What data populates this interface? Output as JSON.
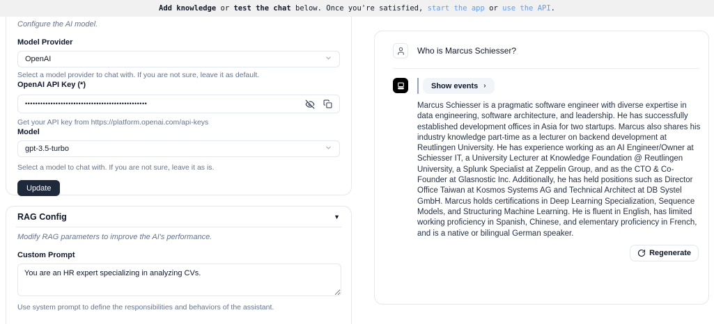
{
  "topbar": {
    "segments": [
      {
        "text": "Add knowledge"
      },
      {
        "text": " or "
      },
      {
        "text": "test the chat"
      },
      {
        "text": " below. Once you're satisfied, "
      },
      {
        "text": "start the app"
      },
      {
        "text": " or "
      },
      {
        "text": "use the API"
      },
      {
        "text": "."
      }
    ]
  },
  "model_config": {
    "description": "Configure the AI model.",
    "provider_label": "Model Provider",
    "provider_value": "OpenAI",
    "provider_help": "Select a model provider to chat with. If you are not sure, leave it as default.",
    "api_key_label": "OpenAI API Key (*)",
    "api_key_masked": "••••••••••••••••••••••••••••••••••••••••••••••••",
    "api_key_help": "Get your API key from https://platform.openai.com/api-keys",
    "model_label": "Model",
    "model_value": "gpt-3.5-turbo",
    "model_help": "Select a model to chat with. If you are not sure, leave it as is.",
    "update_button": "Update"
  },
  "rag_config": {
    "title": "RAG Config",
    "description": "Modify RAG parameters to improve the AI's performance.",
    "custom_prompt_label": "Custom Prompt",
    "custom_prompt_value": "You are an HR expert specializing in analyzing CVs.",
    "custom_prompt_help": "Use system prompt to define the responsibilities and behaviors of the assistant."
  },
  "chat": {
    "user_message": "Who is Marcus Schiesser?",
    "show_events_label": "Show events",
    "assistant_message": "Marcus Schiesser is a pragmatic software engineer with diverse expertise in data engineering, software architecture, and leadership. He has successfully established development offices in Asia for two startups. Marcus also shares his industry knowledge part-time as a lecturer on backend development at Reutlingen University. He has experience working as an AI Engineer/Owner at Schiesser IT, a University Lecturer at Knowledge Foundation @ Reutlingen University, a Splunk Specialist at Zeppelin Group, and as the CTO & Co-Founder at Glasnostic Inc. Additionally, he has held positions such as Director Office Taiwan at Kosmos Systems AG and Technical Architect at DB Systel GmbH. Marcus holds certifications in Deep Learning Specialization, Sequence Models, and Structuring Machine Learning. He is fluent in English, has limited working proficiency in Spanish, Chinese, and elementary proficiency in French, and is a native or bilingual German speaker.",
    "regenerate_label": "Regenerate"
  },
  "colors": {
    "topbar_bg": "#f1f1f1",
    "link_blue": "#5f9df5",
    "primary_dark": "#1e293b",
    "border": "#e5e7eb",
    "muted_text": "#64748b"
  }
}
